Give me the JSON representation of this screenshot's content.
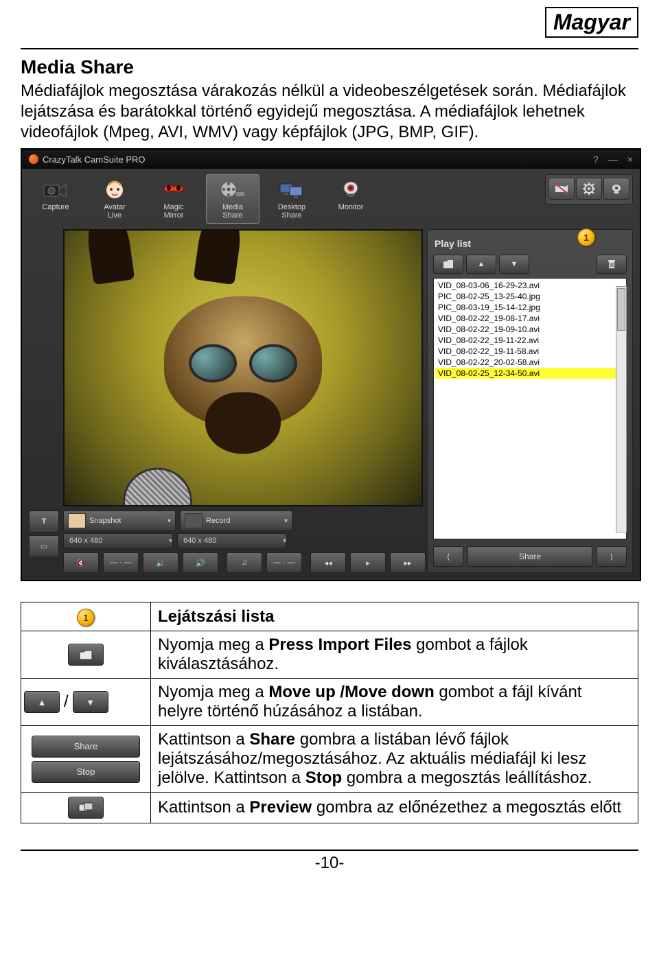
{
  "lang_badge": "Magyar",
  "section_title": "Media Share",
  "paragraph1": "Médiafájlok megosztása várakozás nélkül a videobeszélgetések során. Médiafájlok lejátszása és barátokkal történő egyidejű megosztása. A médiafájlok lehetnek videofájlok (Mpeg, AVI, WMV) vagy képfájlok (JPG, BMP, GIF).",
  "app": {
    "title": "CrazyTalk CamSuite PRO",
    "toolbar": [
      {
        "label": "Capture"
      },
      {
        "label": "Avatar\nLive"
      },
      {
        "label": "Magic\nMirror"
      },
      {
        "label": "Media\nShare"
      },
      {
        "label": "Desktop\nShare"
      },
      {
        "label": "Monitor"
      }
    ],
    "snapshot_label": "Snapshot",
    "record_label": "Record",
    "res1": "640 x 480",
    "res2": "640 x 480",
    "playlist_title": "Play list",
    "files": [
      "VID_08-03-06_16-29-23.avi",
      "PIC_08-02-25_13-25-40.jpg",
      "PIC_08-03-19_15-14-12.jpg",
      "VID_08-02-22_19-08-17.avi",
      "VID_08-02-22_19-09-10.avi",
      "VID_08-02-22_19-11-22.avi",
      "VID_08-02-22_19-11-58.avi",
      "VID_08-02-22_20-02-58.avi",
      "VID_08-02-25_12-34-50.avi"
    ],
    "share_label": "Share",
    "callout1": "1"
  },
  "table": {
    "row1_badge": "1",
    "row1_text": "Lejátszási lista",
    "row2_pre": "Nyomja meg a ",
    "row2_bold": "Press Import Files",
    "row2_post": " gombot a fájlok kiválasztásához.",
    "row3_sep": "/",
    "row3_pre": "Nyomja meg a ",
    "row3_bold": "Move up /Move down",
    "row3_post": " gombot a fájl kívánt helyre történő húzásához a listában.",
    "share_label": "Share",
    "stop_label": "Stop",
    "row4_p1": "Kattintson a ",
    "row4_b1": "Share",
    "row4_p2": " gombra a listában lévő fájlok lejátszásához/megosztásához. Az aktuális médiafájl ki lesz jelölve. Kattintson a ",
    "row4_b2": "Stop",
    "row4_p3": " gombra a megosztás leállításhoz.",
    "row5_p1": "Kattintson a ",
    "row5_b1": "Preview",
    "row5_p2": " gombra az előnézethez a megosztás előtt"
  },
  "page_number": "-10-"
}
